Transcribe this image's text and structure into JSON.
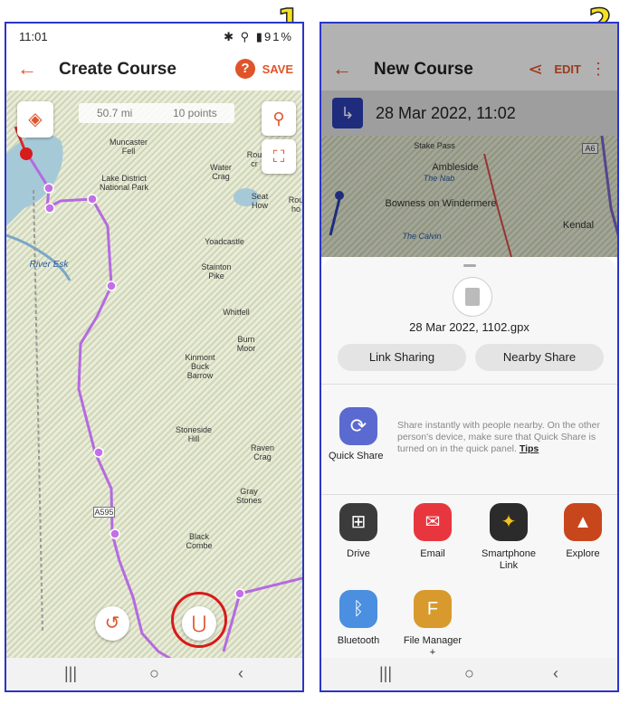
{
  "step_labels": [
    "1",
    "2"
  ],
  "phone1": {
    "status": {
      "time": "11:01",
      "battery": "91%"
    },
    "title": "Create Course",
    "save_label": "SAVE",
    "help_label": "?",
    "stats": {
      "distance": "50.7 mi",
      "points": "10 points"
    },
    "map_labels": [
      "Muncaster Fell",
      "Lake District National Park",
      "Water Crag",
      "Rou cr",
      "Seat How",
      "Rou ho",
      "Yoadcastle",
      "Stainton Pike",
      "River Esk",
      "Whitfell",
      "Burn Moor",
      "Kinmont Buck Barrow",
      "Stoneside Hill",
      "Raven Crag",
      "Gray Stones",
      "Black Combe",
      "A595"
    ]
  },
  "phone2": {
    "title": "New Course",
    "edit_label": "EDIT",
    "course_datetime": "28 Mar 2022, 11:02",
    "map_labels": [
      "Ambleside",
      "The Nab",
      "Bowness on Windermere",
      "Kendal",
      "The Calvin",
      "Stake Pass",
      "A6"
    ],
    "share": {
      "file_name": "28 Mar 2022, 1102.gpx",
      "link_sharing": "Link Sharing",
      "nearby_share": "Nearby Share",
      "quick_share_label": "Quick Share",
      "quick_share_desc": "Share instantly with people nearby. On the other person's device, make sure that Quick Share is turned on in the quick panel.",
      "tips_label": "Tips",
      "apps": [
        {
          "name": "Drive",
          "icon": "drive-icon",
          "color": "#3b3b3b"
        },
        {
          "name": "Email",
          "icon": "email-icon",
          "color": "#e8363f"
        },
        {
          "name": "Smartphone Link",
          "icon": "garmin-smartphone-link-icon",
          "color": "#2b2b2b"
        },
        {
          "name": "Explore",
          "icon": "garmin-explore-icon",
          "color": "#c8461c"
        },
        {
          "name": "Bluetooth",
          "icon": "bluetooth-icon",
          "color": "#4a8fe0"
        },
        {
          "name": "File Manager +",
          "icon": "file-manager-icon",
          "color": "#d89a2c"
        }
      ]
    }
  },
  "nav": {
    "recents": "|||",
    "home": "○",
    "back": "‹"
  }
}
